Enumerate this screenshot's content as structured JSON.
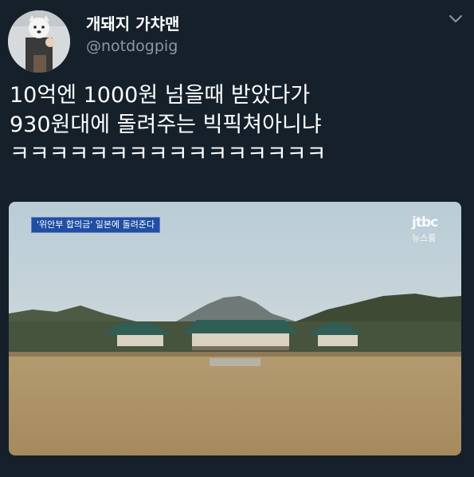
{
  "tweet": {
    "display_name": "개돼지 가챠맨",
    "handle": "@notdogpig",
    "text_lines": [
      "10억엔 1000원 넘을때 받았다가",
      "930원대에 돌려주는 빅픽쳐아니냐",
      "ㅋㅋㅋㅋㅋㅋㅋㅋㅋㅋㅋㅋㅋㅋㅋㅋ"
    ]
  },
  "media": {
    "caption": "'위안부 합의금' 일본에 돌려준다",
    "logo_main": "jtbc",
    "logo_sub": "뉴스룸"
  },
  "icons": {
    "menu": "chevron-down-icon"
  },
  "colors": {
    "background": "#15202b",
    "secondary_text": "#8899a6",
    "caption_bg": "#1f4ea3"
  }
}
